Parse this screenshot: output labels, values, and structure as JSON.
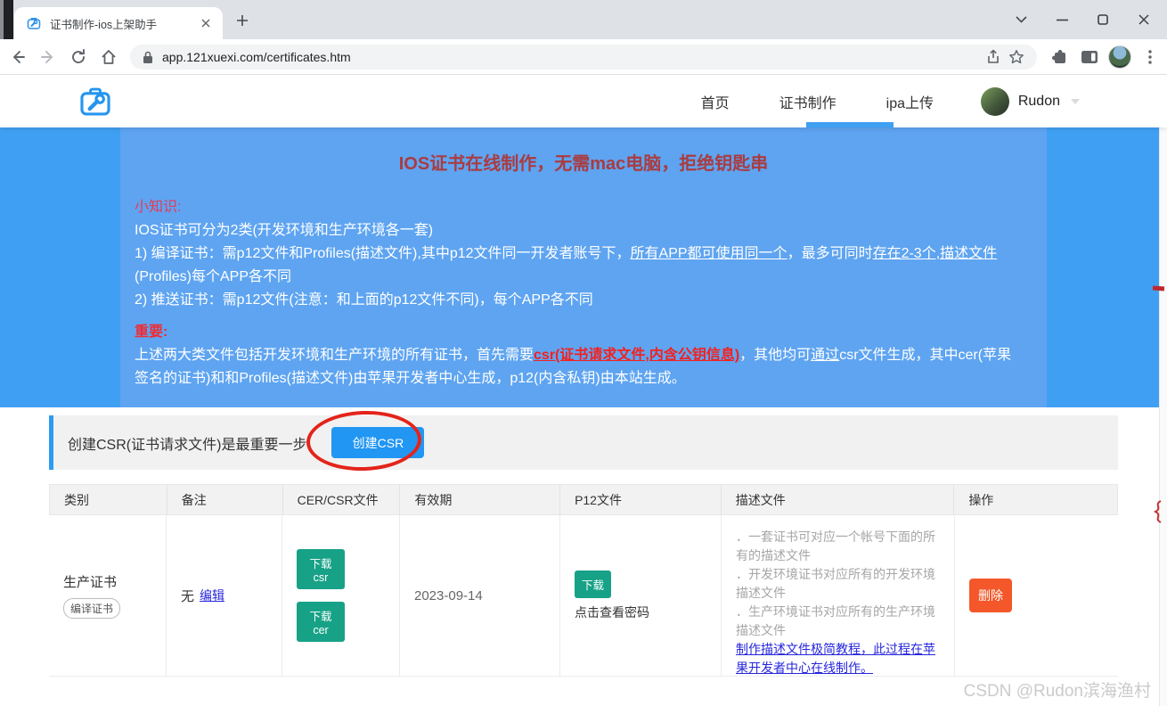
{
  "browser": {
    "tab_title": "证书制作-ios上架助手",
    "url": "app.121xuexi.com/certificates.htm"
  },
  "header": {
    "nav_home": "首页",
    "nav_cert": "证书制作",
    "nav_ipa": "ipa上传",
    "username": "Rudon"
  },
  "hero": {
    "title": "IOS证书在线制作，无需mac电脑，拒绝钥匙串",
    "tip_label": "小知识:",
    "line1": "IOS证书可分为2类(开发环境和生产环境各一套)",
    "line2_pre": "1) 编译证书：需p12文件和Profiles(描述文件),其中p12文件同一开发者账号下，",
    "line2_u1": "所有APP都可使用同一个",
    "line2_mid": "，最多可同时",
    "line2_u2": "存在2-3个,描述文件",
    "line2_wrap": "(Profiles)每个APP各不同",
    "line3": "2) 推送证书：需p12文件(注意：和上面的p12文件不同)，每个APP各不同",
    "important_label": "重要:",
    "imp_pre": "上述两大类文件包括开发环境和生产环境的所有证书，首先需要",
    "imp_red": "csr(证书请求文件,内含公钥信息)",
    "imp_mid": "，其他均可",
    "imp_underline": "通过",
    "imp_post1": "csr文件生成，其中cer(苹果",
    "imp_post2": "签名的证书)和和Profiles(描述文件)由苹果开发者中心生成，p12(内含私钥)由本站生成。"
  },
  "callout": {
    "text": "创建CSR(证书请求文件)是最重要一步",
    "button_label": "创建CSR"
  },
  "table": {
    "headers": [
      "类别",
      "备注",
      "CER/CSR文件",
      "有效期",
      "P12文件",
      "描述文件",
      "操作"
    ],
    "row": {
      "category": "生产证书",
      "category_badge": "编译证书",
      "note": "无",
      "note_link": "编辑",
      "csr_button": "下载csr",
      "cer_button": "下载cer",
      "expiry": "2023-09-14",
      "p12_button": "下载",
      "p12_hint": "点击查看密码",
      "desc_lines": [
        "．一套证书可对应一个帐号下面的所有的描述文件",
        "．开发环境证书对应所有的开发环境描述文件",
        "．生产环境证书对应所有的生产环境描述文件"
      ],
      "desc_link": "制作描述文件极简教程，此过程在苹果开发者中心在线制作。",
      "delete_button": "删除"
    }
  },
  "watermark": "CSDN @Rudon滨海渔村",
  "colors": {
    "accent_blue": "#2196f3",
    "hero_outer": "#3fa0f3",
    "hero_inner": "#5ea4f1",
    "teal_button": "#17a287",
    "delete_orange": "#f4582a",
    "annotation_red": "#e3241a",
    "link_blue": "#2727dd"
  }
}
